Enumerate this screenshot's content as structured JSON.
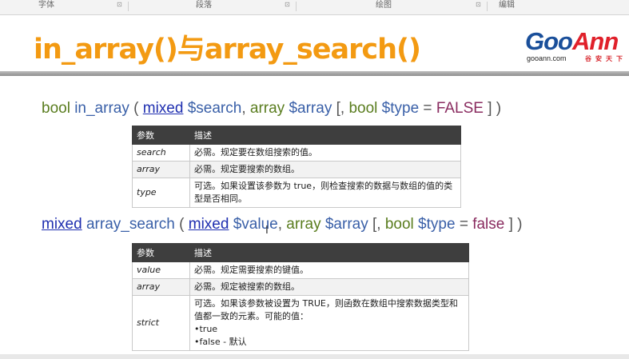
{
  "ribbon": {
    "groups": [
      "字体",
      "段落",
      "绘图",
      "编辑"
    ],
    "launcher_glyph": "⊡"
  },
  "slide": {
    "title": "in_array()与array_search()",
    "logo": {
      "mark_left": "Goo",
      "mark_right": "Ann",
      "site": "gooann.com",
      "cn": "谷安天下"
    },
    "colors": {
      "title": "#f39a12",
      "type": "#5a7d1f",
      "link": "#1f2fb0",
      "variable": "#3a60a8",
      "constant": "#8a2c60"
    },
    "in_array": {
      "signature": {
        "ret": "bool",
        "fn": "in_array",
        "open": "(",
        "p1_type": "mixed",
        "p1_var": "$search",
        "comma1": ",",
        "p2_type": "array",
        "p2_var": "$array",
        "opt_open": "[,",
        "p3_type": "bool",
        "p3_var": "$type",
        "eq": "=",
        "p3_default": "FALSE",
        "close": "] )"
      },
      "headers": [
        "参数",
        "描述"
      ],
      "rows": [
        {
          "name": "search",
          "desc": "必需。规定要在数组搜索的值。"
        },
        {
          "name": "array",
          "desc": "必需。规定要搜索的数组。"
        },
        {
          "name": "type",
          "desc": "可选。如果设置该参数为 true，则检查搜索的数据与数组的值的类型是否相同。"
        }
      ]
    },
    "array_search": {
      "signature": {
        "ret": "mixed",
        "fn": "array_search",
        "open": "(",
        "p1_type": "mixed",
        "p1_var": "$value",
        "comma1": ",",
        "p2_type": "array",
        "p2_var": "$array",
        "opt_open": "[,",
        "p3_type": "bool",
        "p3_var": "$type",
        "eq": "=",
        "p3_default": "false",
        "close": "] )"
      },
      "headers": [
        "参数",
        "描述"
      ],
      "rows": [
        {
          "name": "value",
          "desc": "必需。规定需要搜索的键值。"
        },
        {
          "name": "array",
          "desc": "必需。规定被搜索的数组。"
        },
        {
          "name": "strict",
          "desc": "可选。如果该参数被设置为 TRUE，则函数在数组中搜索数据类型和值都一致的元素。可能的值：",
          "opt1": "•true",
          "opt2": "•false - 默认"
        }
      ]
    },
    "text_cursor": "I"
  }
}
